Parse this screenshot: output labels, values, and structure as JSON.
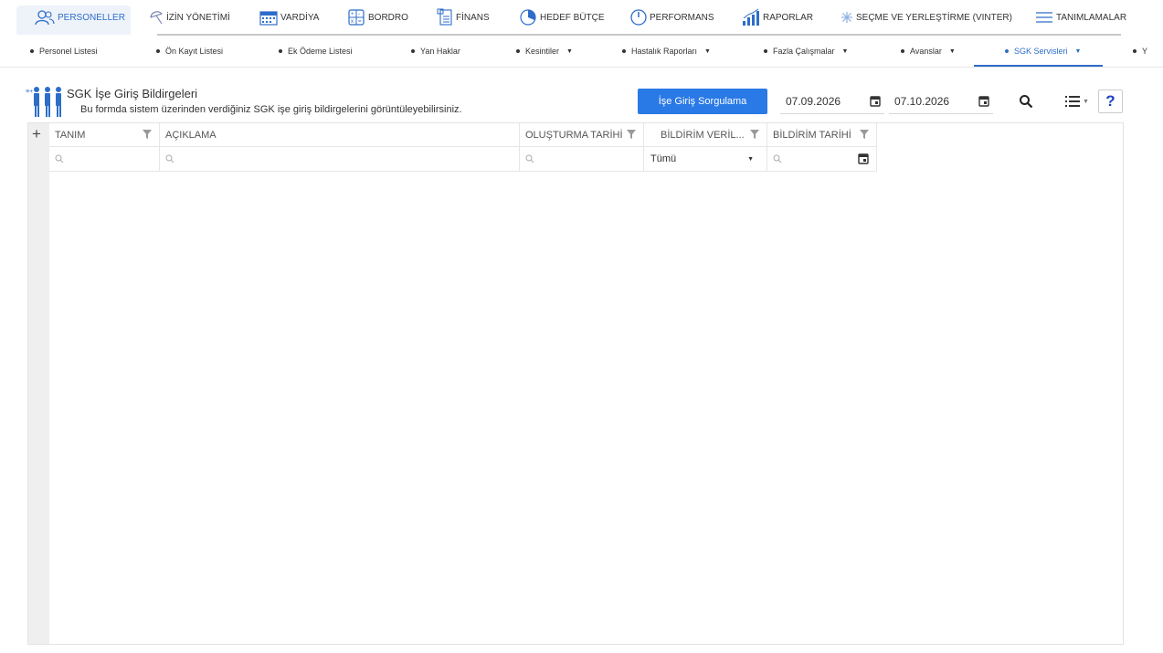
{
  "top_nav": {
    "items": [
      {
        "label": "PERSONELLER",
        "icon": "people-icon",
        "active": true
      },
      {
        "label": "İZİN YÖNETİMİ",
        "icon": "umbrella-icon"
      },
      {
        "label": "VARDİYA",
        "icon": "calendar-icon"
      },
      {
        "label": "BORDRO",
        "icon": "calculator-icon"
      },
      {
        "label": "FİNANS",
        "icon": "document-icon"
      },
      {
        "label": "HEDEF BÜTÇE",
        "icon": "pie-chart-icon"
      },
      {
        "label": "PERFORMANS",
        "icon": "gauge-icon"
      },
      {
        "label": "RAPORLAR",
        "icon": "bar-chart-icon"
      },
      {
        "label": "SEÇME VE YERLEŞTİRME (VINTER)",
        "icon": "snowflake-icon"
      },
      {
        "label": "TANIMLAMALAR",
        "icon": "menu-icon"
      }
    ]
  },
  "sub_nav": {
    "items": [
      {
        "label": "Personel Listesi"
      },
      {
        "label": "Ön Kayıt Listesi"
      },
      {
        "label": "Ek Ödeme Listesi"
      },
      {
        "label": "Yan Haklar"
      },
      {
        "label": "Kesintiler"
      },
      {
        "label": "Hastalık Raporları"
      },
      {
        "label": "Fazla Çalışmalar"
      },
      {
        "label": "Avanslar"
      },
      {
        "label": "SGK Servisleri",
        "active": true
      },
      {
        "label": "Y"
      }
    ]
  },
  "page": {
    "title": "SGK İşe Giriş Bildirgeleri",
    "description": "Bu formda sistem üzerinden verdiğiniz SGK işe giriş bildirgelerini görüntüleyebilirsiniz.",
    "query_button": "İşe Giriş Sorgulama",
    "start_date": "07.09.2026",
    "end_date": "07.10.2026",
    "help_label": "?"
  },
  "grid": {
    "add_label": "+",
    "columns": [
      "TANIM",
      "AÇIKLAMA",
      "OLUŞTURMA TARİHİ",
      "BİLDİRİM VERİL...",
      "BİLDİRİM TARİHİ"
    ],
    "status_filter": "Tümü"
  },
  "colors": {
    "accent": "#2d6dc9",
    "button": "#2979e6",
    "help": "#1a3fc6"
  }
}
